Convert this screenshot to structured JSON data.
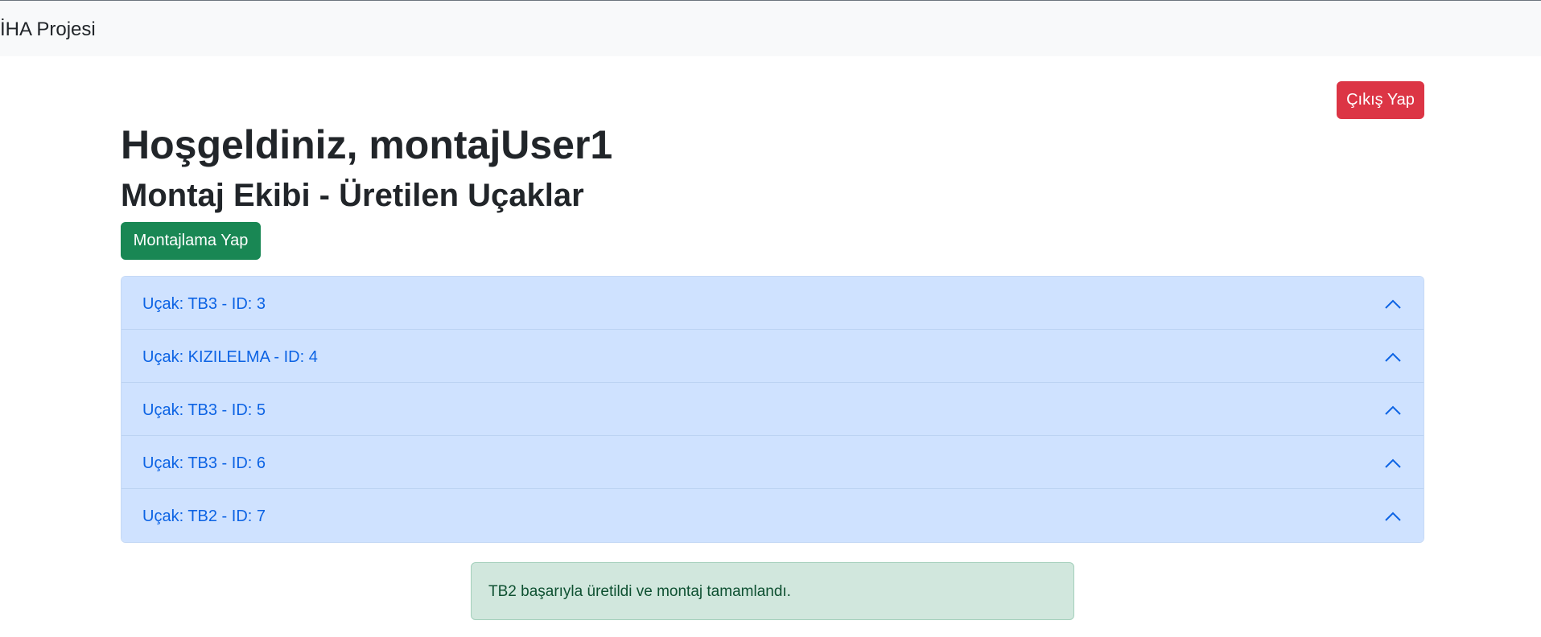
{
  "navbar": {
    "brand": "İHA Projesi"
  },
  "header": {
    "logout_label": "Çıkış Yap",
    "welcome": "Hoşgeldiniz, montajUser1",
    "subtitle": "Montaj Ekibi - Üretilen Uçaklar",
    "assemble_label": "Montajlama Yap"
  },
  "aircraft": [
    {
      "label": "Uçak: TB3 - ID: 3",
      "icon": "chevron-up-icon"
    },
    {
      "label": "Uçak: KIZILELMA - ID: 4",
      "icon": "chevron-up-icon"
    },
    {
      "label": "Uçak: TB3 - ID: 5",
      "icon": "chevron-up-icon"
    },
    {
      "label": "Uçak: TB3 - ID: 6",
      "icon": "chevron-up-icon"
    },
    {
      "label": "Uçak: TB2 - ID: 7",
      "icon": "chevron-up-icon"
    }
  ],
  "alert": {
    "message": "TB2 başarıyla üretildi ve montaj tamamlandı."
  },
  "colors": {
    "danger": "#dc3545",
    "success": "#198754",
    "accordion_bg": "#cfe2ff",
    "accordion_text": "#0c63e4",
    "alert_bg": "#d1e7dd",
    "alert_text": "#0f5132"
  }
}
